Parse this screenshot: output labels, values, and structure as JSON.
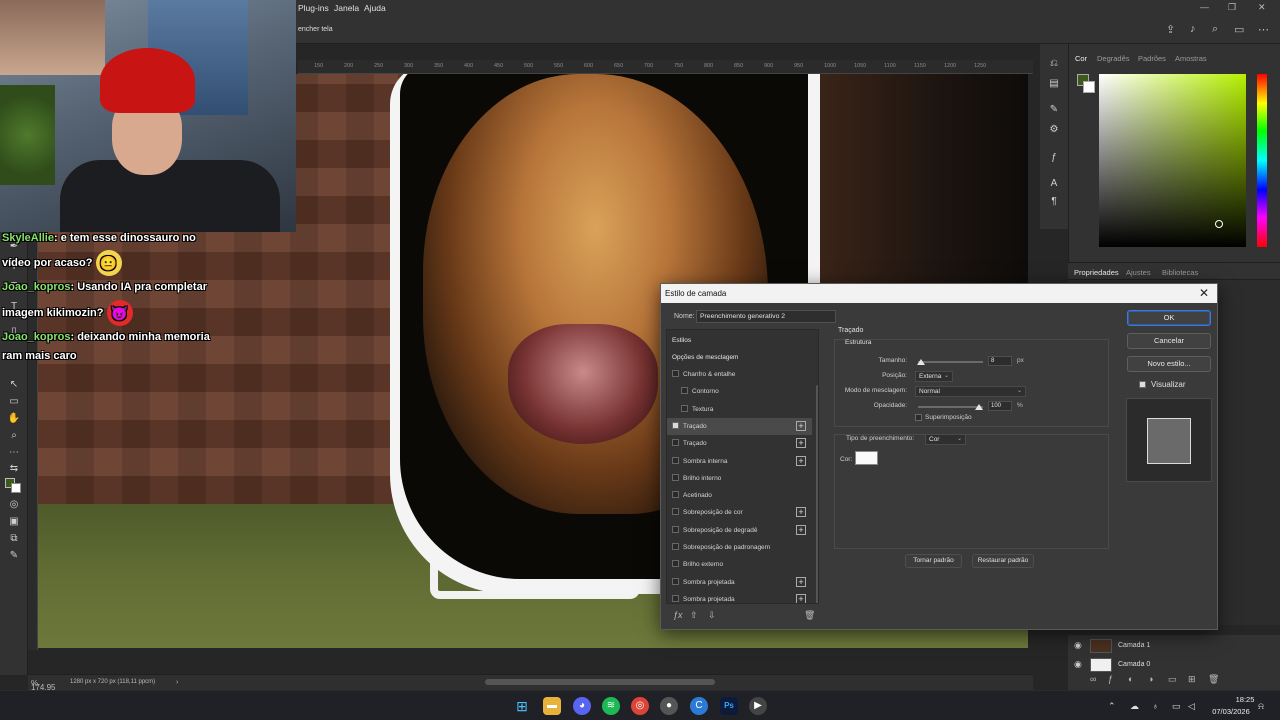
{
  "menubar": {
    "items": [
      "Plug-ins",
      "Janela",
      "Ajuda"
    ]
  },
  "optionsbar": {
    "partial_label": "encher tela"
  },
  "ruler": {
    "ticks": [
      "150",
      "200",
      "250",
      "300",
      "350",
      "400",
      "450",
      "500",
      "550",
      "600",
      "650",
      "700",
      "750",
      "800",
      "850",
      "900",
      "950",
      "1000",
      "1050",
      "1100",
      "1150",
      "1200",
      "1250"
    ]
  },
  "status": {
    "zoom": "174.95",
    "doc_info": "1280 px x 720 px (118,11 ppcm)"
  },
  "color_panel": {
    "tabs": [
      "Cor",
      "Degradês",
      "Padrões",
      "Amostras"
    ],
    "foreground": "#3c5a1c",
    "background": "#ffffff"
  },
  "props_panel": {
    "tabs": [
      "Propriedades",
      "Ajustes",
      "Bibliotecas"
    ]
  },
  "layers": {
    "items": [
      {
        "name": "Camada 1"
      },
      {
        "name": "Camada 0"
      }
    ]
  },
  "chat": {
    "messages": [
      {
        "user": "SkyleAllie",
        "text": "e tem esse dinossauro no",
        "text2": "vídeo por acaso?",
        "emoji": "😐"
      },
      {
        "user": "Joao_kopros",
        "text": "Usando IA pra completar",
        "text2": "imagem kikimozin?",
        "emoji": "😈"
      },
      {
        "user": "Joao_kopros",
        "text": "deixando minha memoria",
        "text2": "ram mais caro"
      }
    ]
  },
  "dialog": {
    "title": "Estilo de camada",
    "name_label": "Nome:",
    "name_value": "Preenchimento generativo 2",
    "style_list": {
      "header": "Estilos",
      "blend_options": "Opções de mesclagem",
      "items": [
        {
          "label": "Chanfro & entalhe",
          "checked": false,
          "plus": false,
          "sub": false
        },
        {
          "label": "Contorno",
          "checked": false,
          "plus": false,
          "sub": true
        },
        {
          "label": "Textura",
          "checked": false,
          "plus": false,
          "sub": true
        },
        {
          "label": "Traçado",
          "checked": true,
          "plus": true,
          "sub": false,
          "selected": true
        },
        {
          "label": "Traçado",
          "checked": false,
          "plus": true,
          "sub": false
        },
        {
          "label": "Sombra interna",
          "checked": false,
          "plus": true,
          "sub": false
        },
        {
          "label": "Brilho interno",
          "checked": false,
          "plus": false,
          "sub": false
        },
        {
          "label": "Acetinado",
          "checked": false,
          "plus": false,
          "sub": false
        },
        {
          "label": "Sobreposição de cor",
          "checked": false,
          "plus": true,
          "sub": false
        },
        {
          "label": "Sobreposição de degradê",
          "checked": false,
          "plus": true,
          "sub": false
        },
        {
          "label": "Sobreposição de padronagem",
          "checked": false,
          "plus": false,
          "sub": false
        },
        {
          "label": "Brilho externo",
          "checked": false,
          "plus": false,
          "sub": false
        },
        {
          "label": "Sombra projetada",
          "checked": false,
          "plus": true,
          "sub": false
        },
        {
          "label": "Sombra projetada",
          "checked": false,
          "plus": true,
          "sub": false
        }
      ]
    },
    "stroke": {
      "section": "Traçado",
      "structure": "Estrutura",
      "size_label": "Tamanho:",
      "size_value": "8",
      "size_unit": "px",
      "position_label": "Posição:",
      "position_value": "Externa",
      "blend_label": "Modo de mesclagem:",
      "blend_value": "Normal",
      "opacity_label": "Opacidade:",
      "opacity_value": "100",
      "opacity_unit": "%",
      "overprint_label": "Superimposição",
      "fill_type_label": "Tipo de preenchimento:",
      "fill_type_value": "Cor",
      "color_label": "Cor:",
      "stroke_color": "#ffffff",
      "make_default": "Tornar padrão",
      "reset_default": "Restaurar padrão"
    },
    "buttons": {
      "ok": "OK",
      "cancel": "Cancelar",
      "new_style": "Novo estilo...",
      "preview": "Visualizar"
    }
  },
  "taskbar": {
    "time": "18:25",
    "date": "07/03/2026"
  }
}
